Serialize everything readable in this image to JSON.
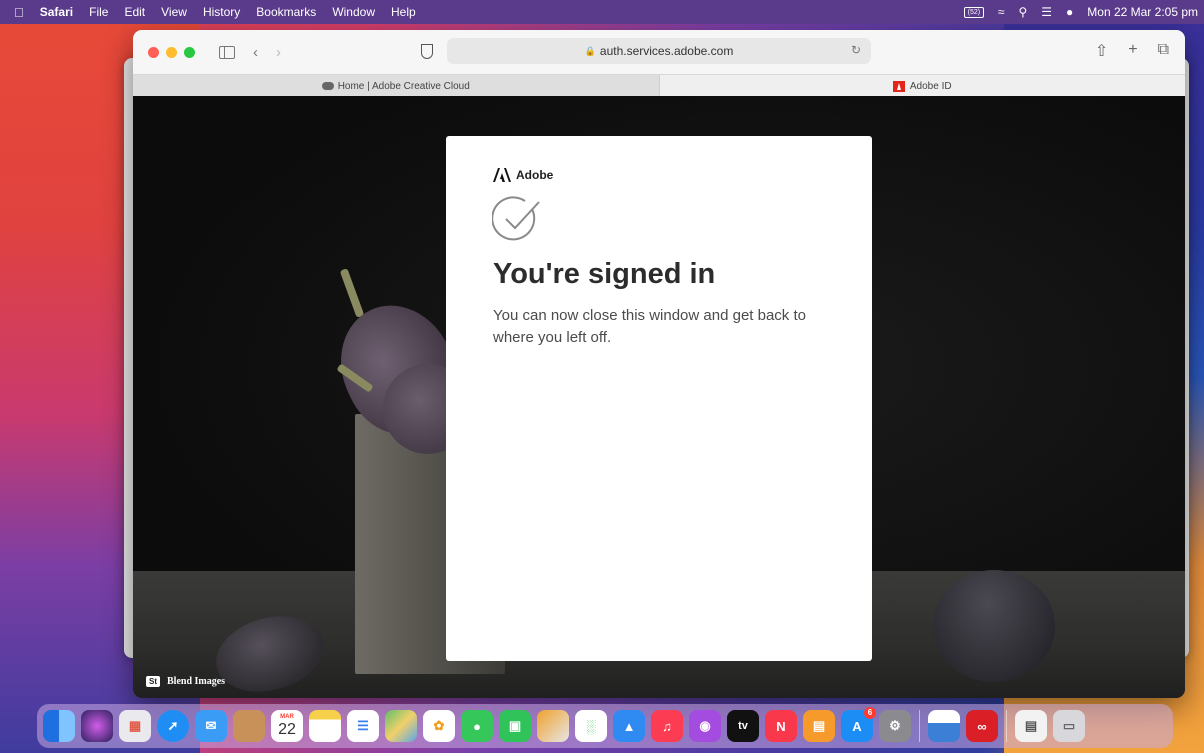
{
  "menubar": {
    "apple": "",
    "app": "Safari",
    "items": [
      "File",
      "Edit",
      "View",
      "History",
      "Bookmarks",
      "Window",
      "Help"
    ],
    "battery": "(52)",
    "clock": "Mon 22 Mar  2:05 pm"
  },
  "browser": {
    "url": "auth.services.adobe.com",
    "tabs": [
      {
        "label": "Home | Adobe Creative Cloud",
        "icon": "creative-cloud-icon"
      },
      {
        "label": "Adobe ID",
        "icon": "adobe-icon"
      }
    ]
  },
  "card": {
    "brand": "Adobe",
    "title": "You're signed in",
    "message": "You can now close this window and get back to where you left off."
  },
  "photo_credit": {
    "badge": "St",
    "text": "Blend Images"
  },
  "dock": {
    "calendar_month": "MAR",
    "calendar_day": "22",
    "appstore_badge": "6",
    "tv_label": "tv",
    "icons": [
      "finder",
      "siri",
      "launchpad",
      "safari",
      "mail",
      "contacts",
      "calendar",
      "notes",
      "reminders",
      "maps",
      "photos",
      "messages",
      "facetime",
      "pages",
      "numbers",
      "keynote",
      "music",
      "podcasts",
      "tv",
      "news",
      "books",
      "app-store",
      "system-preferences",
      "preview",
      "creative-cloud",
      "documents",
      "trash"
    ],
    "colors": {
      "finder": "#3d8ef0",
      "siri": "#222",
      "launchpad": "#e9e9ee",
      "safari": "#1e8ef5",
      "mail": "#3b9cf6",
      "contacts": "#c9915a",
      "calendar": "#ffffff",
      "notes": "#f7d04b",
      "reminders": "#ffffff",
      "maps": "#5fbf6b",
      "photos": "#ffffff",
      "messages": "#35c759",
      "facetime": "#2fc35a",
      "pages": "#f1a12c",
      "numbers": "#3ec254",
      "keynote": "#2f8bf2",
      "music": "#fb3c52",
      "podcasts": "#a44ce0",
      "tv": "#111111",
      "news": "#f9394b",
      "books": "#f79a2c",
      "app-store": "#1c8df5",
      "system-preferences": "#8b8b8f",
      "preview": "#3b7fd6",
      "creative-cloud": "#da1f26",
      "documents": "#f2f2f2",
      "trash": "#d8d8dc"
    }
  }
}
